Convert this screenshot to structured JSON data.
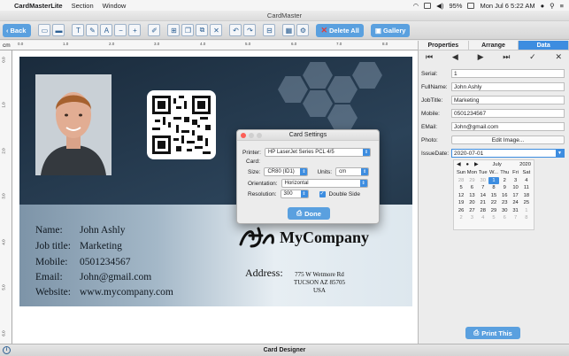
{
  "menubar": {
    "app_name": "CardMasterLite",
    "items": [
      "Section",
      "Window"
    ],
    "battery": "95%",
    "clock": "Mon Jul 6  5:22 AM"
  },
  "window": {
    "title": "CardMaster"
  },
  "toolbar": {
    "back_label": "Back",
    "delete_all_label": "Delete All",
    "gallery_label": "Gallery"
  },
  "ruler": {
    "unit": "cm",
    "top_ticks": [
      "0.0",
      "1.0",
      "2.0",
      "3.0",
      "4.0",
      "5.0",
      "6.0",
      "7.0",
      "8.0"
    ],
    "left_ticks": [
      "0.0",
      "1.0",
      "2.0",
      "3.0",
      "4.0",
      "5.0",
      "6.0"
    ]
  },
  "card": {
    "name_label": "Name:",
    "name_value": "John Ashly",
    "job_label": "Job title:",
    "job_value": "Marketing",
    "mobile_label": "Mobile:",
    "mobile_value": "0501234567",
    "email_label": "Email:",
    "email_value": "John@gmail.com",
    "website_label": "Website:",
    "website_value": "www.mycompany.com",
    "company_name": "MyCompany",
    "address_label": "Address:",
    "address_line1": "775 W Wetmore Rd",
    "address_line2": "TUCSON AZ 85705",
    "address_line3": "USA"
  },
  "dialog": {
    "title": "Card Settings",
    "printer_label": "Printer:",
    "printer_value": "HP LaserJet Series PCL 4/5",
    "card_section": "Card:",
    "size_label": "Size:",
    "size_value": "CR80 (ID1)",
    "units_label": "Units:",
    "units_value": "cm",
    "orientation_label": "Orientation:",
    "orientation_value": "Horizontal",
    "resolution_label": "Resolution:",
    "resolution_value": "300",
    "double_side_label": "Double Side",
    "double_side_checked": true,
    "done_label": "Done"
  },
  "panel": {
    "tabs": [
      "Properties",
      "Arrange",
      "Data"
    ],
    "active_tab": "Data",
    "fields": {
      "serial_label": "Serial:",
      "serial_value": "1",
      "fullname_label": "FullName:",
      "fullname_value": "John Ashly",
      "jobtitle_label": "JobTitle:",
      "jobtitle_value": "Marketing",
      "mobile_label": "Mobile:",
      "mobile_value": "0501234567",
      "email_label": "EMail:",
      "email_value": "John@gmail.com",
      "photo_label": "Photo:",
      "photo_button": "Edit Image...",
      "issuedate_label": "IssueDate:",
      "issuedate_value": "2020-07-01"
    },
    "calendar": {
      "month": "July",
      "year": "2020",
      "weekdays": [
        "Sun",
        "Mon",
        "Tue",
        "W...",
        "Thu",
        "Fri",
        "Sat"
      ],
      "rows": [
        [
          "28",
          "29",
          "30",
          "1",
          "2",
          "3",
          "4"
        ],
        [
          "5",
          "6",
          "7",
          "8",
          "9",
          "10",
          "11"
        ],
        [
          "12",
          "13",
          "14",
          "15",
          "16",
          "17",
          "18"
        ],
        [
          "19",
          "20",
          "21",
          "22",
          "23",
          "24",
          "25"
        ],
        [
          "26",
          "27",
          "28",
          "29",
          "30",
          "31",
          "1"
        ],
        [
          "2",
          "3",
          "4",
          "5",
          "6",
          "7",
          "8"
        ]
      ],
      "selected": "1"
    },
    "print_label": "Print This"
  },
  "status": {
    "text": "Card Designer"
  },
  "colors": {
    "accent": "#3d8de0",
    "button": "#5aa0df",
    "delete_x": "#e23a3a"
  }
}
